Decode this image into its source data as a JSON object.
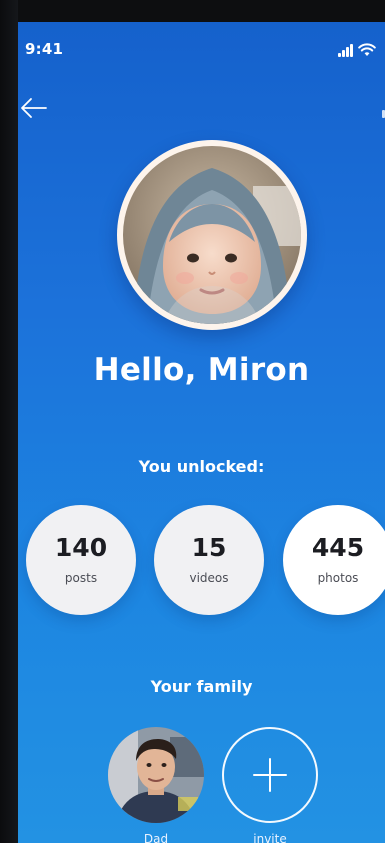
{
  "status_bar": {
    "time": "9:41"
  },
  "navigation": {
    "back_icon": "arrow-left-icon"
  },
  "profile": {
    "greeting": "Hello, Miron",
    "avatar": "child-in-towel-photo"
  },
  "unlocked": {
    "title": "You unlocked:",
    "stats": [
      {
        "value": "140",
        "label": "posts"
      },
      {
        "value": "15",
        "label": "videos"
      },
      {
        "value": "445",
        "label": "photos"
      }
    ]
  },
  "family": {
    "title": "Your family",
    "members": [
      {
        "name": "Dad",
        "avatar": "man-portrait-photo"
      },
      {
        "name": "invite",
        "icon": "plus-icon"
      }
    ]
  },
  "colors": {
    "gradient_top": "#1561cc",
    "gradient_bottom": "#2392e3",
    "stat_text": "#1c1d22",
    "white": "#ffffff"
  }
}
